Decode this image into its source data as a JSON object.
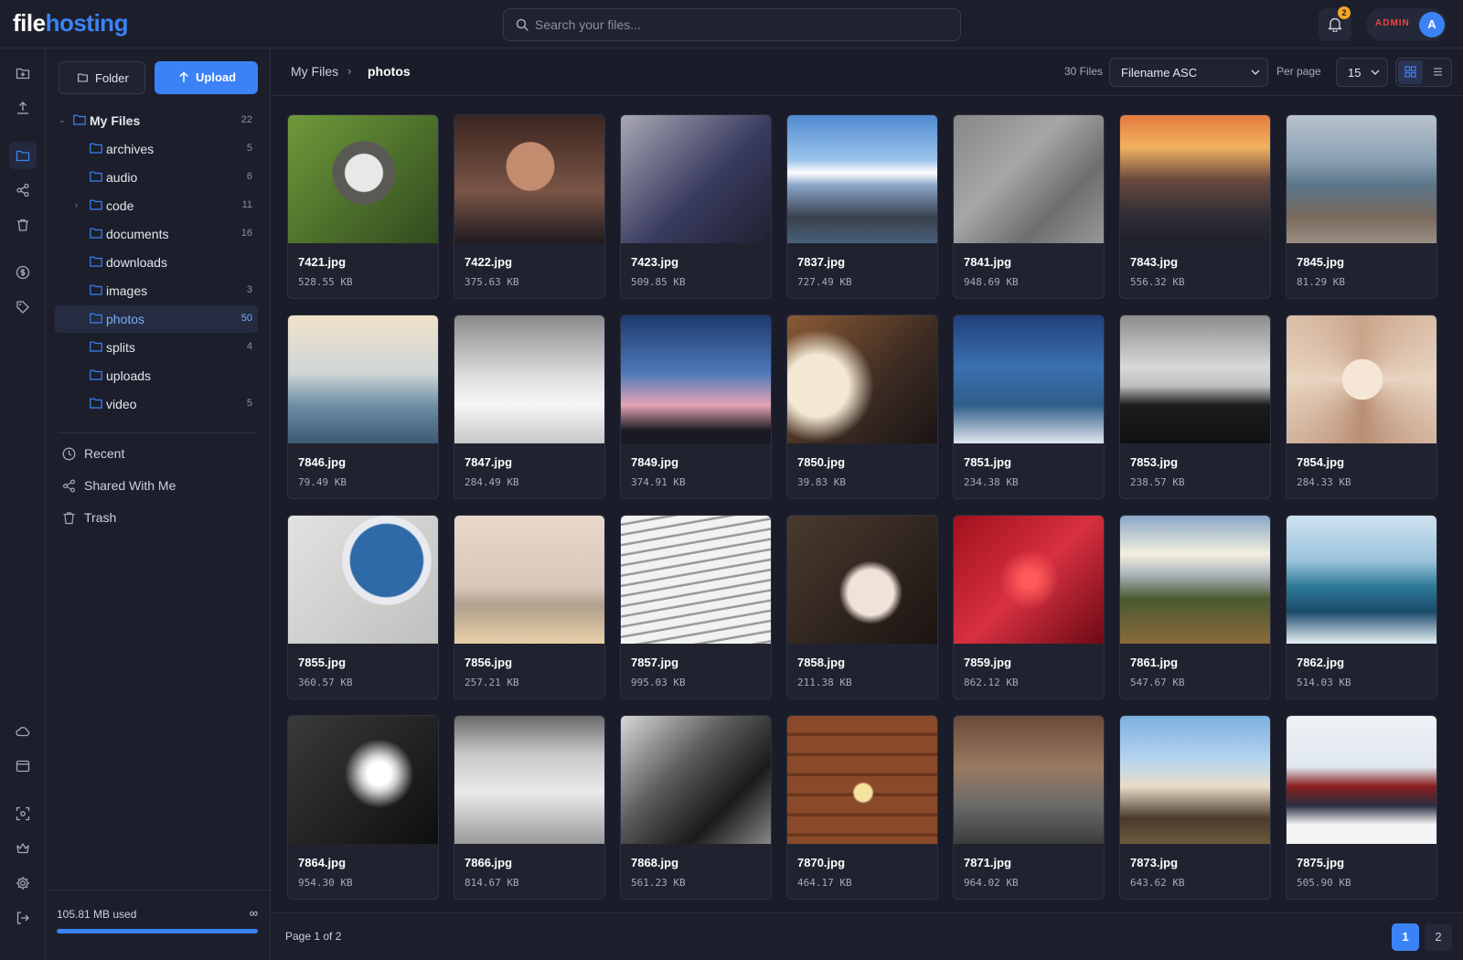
{
  "app": {
    "logo_part1": "file",
    "logo_part2": "hosting"
  },
  "header": {
    "search_placeholder": "Search your files...",
    "notification_count": "2",
    "role_badge": "ADMIN",
    "avatar_letter": "A"
  },
  "rail": {
    "icons": [
      "new-folder-icon",
      "upload-icon",
      "folder-icon",
      "share-icon",
      "trash-icon",
      "currency-icon",
      "tag-icon",
      "cloud-icon",
      "browser-window-icon",
      "scan-icon",
      "crown-icon",
      "gear-icon",
      "logout-icon"
    ],
    "active_icon": "folder-icon"
  },
  "sidebar": {
    "folder_button": "Folder",
    "upload_button": "Upload",
    "root": {
      "label": "My Files",
      "count": "22"
    },
    "folders": [
      {
        "label": "archives",
        "count": "5",
        "expandable": false
      },
      {
        "label": "audio",
        "count": "6",
        "expandable": false
      },
      {
        "label": "code",
        "count": "11",
        "expandable": true
      },
      {
        "label": "documents",
        "count": "16",
        "expandable": false
      },
      {
        "label": "downloads",
        "count": "",
        "expandable": false
      },
      {
        "label": "images",
        "count": "3",
        "expandable": false
      },
      {
        "label": "photos",
        "count": "50",
        "expandable": false,
        "selected": true
      },
      {
        "label": "splits",
        "count": "4",
        "expandable": false
      },
      {
        "label": "uploads",
        "count": "",
        "expandable": false
      },
      {
        "label": "video",
        "count": "5",
        "expandable": false
      }
    ],
    "links": [
      {
        "label": "Recent",
        "icon": "clock-icon"
      },
      {
        "label": "Shared With Me",
        "icon": "share-icon"
      },
      {
        "label": "Trash",
        "icon": "trash-icon"
      }
    ],
    "storage": {
      "used_text": "105.81 MB used",
      "limit_symbol": "∞",
      "usage_fraction": 1.0
    }
  },
  "toolbar": {
    "breadcrumb": [
      "My Files",
      "photos"
    ],
    "breadcrumb_separator": "›",
    "file_count": "30 Files",
    "sort_value": "Filename ASC",
    "per_page_label": "Per page",
    "per_page_value": "15",
    "view_mode": "grid"
  },
  "files": [
    {
      "name": "7421.jpg",
      "size": "528.55 KB"
    },
    {
      "name": "7422.jpg",
      "size": "375.63 KB"
    },
    {
      "name": "7423.jpg",
      "size": "509.85 KB"
    },
    {
      "name": "7837.jpg",
      "size": "727.49 KB"
    },
    {
      "name": "7841.jpg",
      "size": "948.69 KB"
    },
    {
      "name": "7843.jpg",
      "size": "556.32 KB"
    },
    {
      "name": "7845.jpg",
      "size": "81.29 KB"
    },
    {
      "name": "7846.jpg",
      "size": "79.49 KB"
    },
    {
      "name": "7847.jpg",
      "size": "284.49 KB"
    },
    {
      "name": "7849.jpg",
      "size": "374.91 KB"
    },
    {
      "name": "7850.jpg",
      "size": "39.83 KB"
    },
    {
      "name": "7851.jpg",
      "size": "234.38 KB"
    },
    {
      "name": "7853.jpg",
      "size": "238.57 KB"
    },
    {
      "name": "7854.jpg",
      "size": "284.33 KB"
    },
    {
      "name": "7855.jpg",
      "size": "360.57 KB"
    },
    {
      "name": "7856.jpg",
      "size": "257.21 KB"
    },
    {
      "name": "7857.jpg",
      "size": "995.03 KB"
    },
    {
      "name": "7858.jpg",
      "size": "211.38 KB"
    },
    {
      "name": "7859.jpg",
      "size": "862.12 KB"
    },
    {
      "name": "7861.jpg",
      "size": "547.67 KB"
    },
    {
      "name": "7862.jpg",
      "size": "514.03 KB"
    },
    {
      "name": "7864.jpg",
      "size": "954.30 KB"
    },
    {
      "name": "7866.jpg",
      "size": "814.67 KB"
    },
    {
      "name": "7868.jpg",
      "size": "561.23 KB"
    },
    {
      "name": "7870.jpg",
      "size": "464.17 KB"
    },
    {
      "name": "7871.jpg",
      "size": "964.02 KB"
    },
    {
      "name": "7873.jpg",
      "size": "643.62 KB"
    },
    {
      "name": "7875.jpg",
      "size": "505.90 KB"
    }
  ],
  "pagination": {
    "info": "Page 1 of 2",
    "pages": [
      "1",
      "2"
    ],
    "current": "1"
  }
}
